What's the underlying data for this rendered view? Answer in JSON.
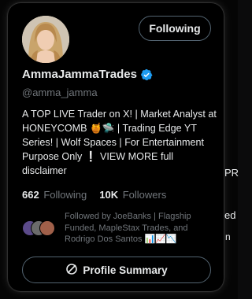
{
  "background": {
    "fragments": [
      "PR",
      "ed",
      "n"
    ]
  },
  "profile": {
    "display_name": "AmmaJammaTrades",
    "handle": "@amma_jamma",
    "follow_button_label": "Following",
    "verified_color": "#1d9bf0",
    "bio": "A TOP LIVE Trader on X! | Market Analyst at HONEYCOMB 🍯🛸 | Trading Edge YT Series! | Wolf Spaces | For Entertainment Purpose Only ❕ VIEW MORE full disclaimer",
    "following_count": "662",
    "following_label": "Following",
    "followers_count": "10K",
    "followers_label": "Followers",
    "followed_by": "Followed by JoeBanks | Flagship Funded, MapleStax Trades, and Rodrigo Dos Santos 📊📈📉",
    "summary_button_label": "Profile Summary"
  },
  "icons": {
    "verified": "verified-badge-icon",
    "summary": "grok-icon"
  }
}
